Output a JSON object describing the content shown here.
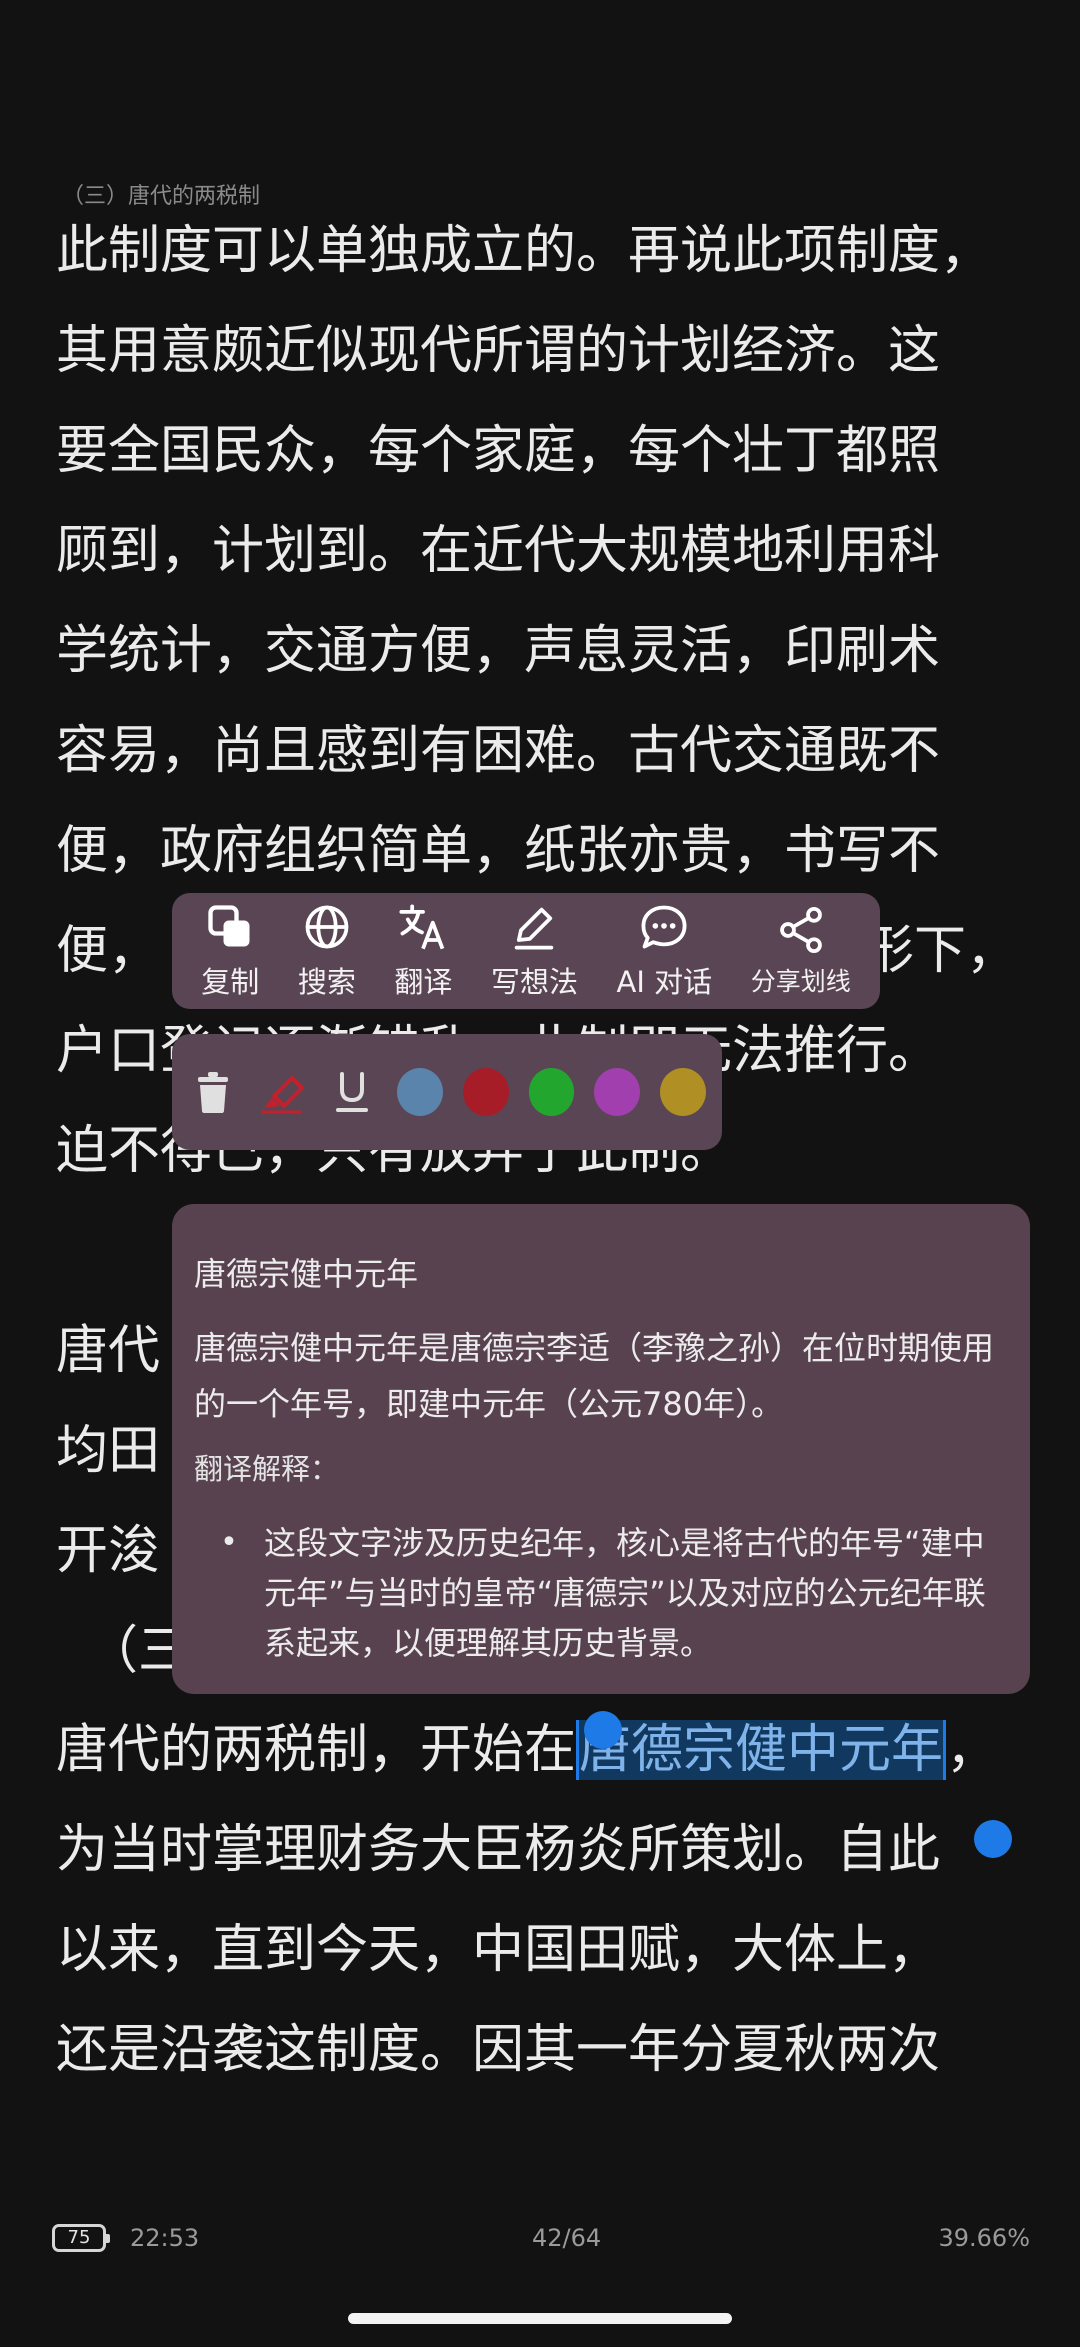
{
  "chapter_header": "（三）唐代的两税制",
  "body_lines_top": [
    "此制度可以单独成立的。再说此项制度，",
    "其用意颇近似现代所谓的计划经济。这",
    "要全国民众，每个家庭，每个壮丁都照",
    "顾到，计划到。在近代大规模地利用科",
    "学统计，交通方便，声息灵活，印刷术",
    "容易，尚且感到有困难。古代交通既不",
    "便，政府组织简单，纸张亦贵，书写不",
    "便，　　　　　　　　　　　　　　形下，",
    "户口登记逐渐错乱，此制即无法推行。",
    "迫不得已，只有放弃了此制。",
    "",
    "唐代",
    "均田",
    "开浚",
    "（三"
  ],
  "selected_paragraph": {
    "before": "唐代的两税制，开始在",
    "selected": "唐德宗健中元年",
    "after": "，"
  },
  "body_lines_bottom": [
    "为当时掌理财务大臣杨炎所策划。自此",
    "以来，直到今天，中国田赋，大体上，",
    "还是沿袭这制度。因其一年分夏秋两次"
  ],
  "action_menu": [
    {
      "label": "复制",
      "icon": "copy-icon"
    },
    {
      "label": "搜索",
      "icon": "globe-icon"
    },
    {
      "label": "翻译",
      "icon": "translate-icon"
    },
    {
      "label": "写想法",
      "icon": "pencil-icon"
    },
    {
      "label": "AI 对话",
      "icon": "chat-bubble-icon"
    },
    {
      "label": "分享划线",
      "icon": "share-icon"
    }
  ],
  "highlight_colors": [
    "#5b84ad",
    "#a61d28",
    "#23a62e",
    "#a23fae",
    "#b08f24"
  ],
  "translation_popup": {
    "title": "唐德宗健中元年",
    "definition": "唐德宗健中元年是唐德宗李适（李豫之孙）在位时期使用的一个年号，即建中元年（公元780年）。",
    "section_label": "翻译解释：",
    "bullet": "这段文字涉及历史纪年，核心是将古代的年号“建中元年”与当时的皇帝“唐德宗”以及对应的公元纪年联系起来，以便理解其历史背景。"
  },
  "status_bar": {
    "battery": "75",
    "time": "22:53",
    "page": "42/64",
    "progress": "39.66%"
  }
}
